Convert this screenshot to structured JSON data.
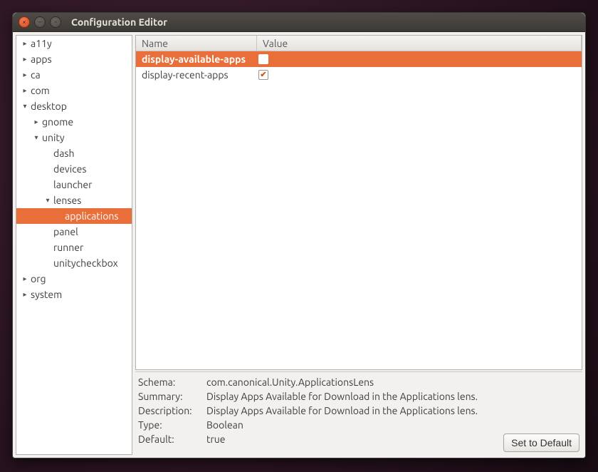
{
  "window": {
    "title": "Configuration Editor"
  },
  "tree": [
    {
      "label": "a11y",
      "depth": 0,
      "exp": "▸",
      "sel": false
    },
    {
      "label": "apps",
      "depth": 0,
      "exp": "▸",
      "sel": false
    },
    {
      "label": "ca",
      "depth": 0,
      "exp": "▸",
      "sel": false
    },
    {
      "label": "com",
      "depth": 0,
      "exp": "▸",
      "sel": false
    },
    {
      "label": "desktop",
      "depth": 0,
      "exp": "▾",
      "sel": false
    },
    {
      "label": "gnome",
      "depth": 1,
      "exp": "▸",
      "sel": false
    },
    {
      "label": "unity",
      "depth": 1,
      "exp": "▾",
      "sel": false
    },
    {
      "label": "dash",
      "depth": 2,
      "exp": "",
      "sel": false
    },
    {
      "label": "devices",
      "depth": 2,
      "exp": "",
      "sel": false
    },
    {
      "label": "launcher",
      "depth": 2,
      "exp": "",
      "sel": false
    },
    {
      "label": "lenses",
      "depth": 2,
      "exp": "▾",
      "sel": false
    },
    {
      "label": "applications",
      "depth": 3,
      "exp": "",
      "sel": true
    },
    {
      "label": "panel",
      "depth": 2,
      "exp": "",
      "sel": false
    },
    {
      "label": "runner",
      "depth": 2,
      "exp": "",
      "sel": false
    },
    {
      "label": "unitycheckbox",
      "depth": 2,
      "exp": "",
      "sel": false
    },
    {
      "label": "org",
      "depth": 0,
      "exp": "▸",
      "sel": false
    },
    {
      "label": "system",
      "depth": 0,
      "exp": "▸",
      "sel": false
    }
  ],
  "columns": {
    "name": "Name",
    "value": "Value"
  },
  "rows": [
    {
      "name": "display-available-apps",
      "checked": false,
      "sel": true
    },
    {
      "name": "display-recent-apps",
      "checked": true,
      "sel": false
    }
  ],
  "details": {
    "schema_label": "Schema:",
    "schema": "com.canonical.Unity.ApplicationsLens",
    "summary_label": "Summary:",
    "summary": "Display Apps Available for Download in the Applications lens.",
    "description_label": "Description:",
    "description": "Display Apps Available for Download in the Applications lens.",
    "type_label": "Type:",
    "type": "Boolean",
    "default_label": "Default:",
    "default": "true",
    "set_default": "Set to Default"
  }
}
